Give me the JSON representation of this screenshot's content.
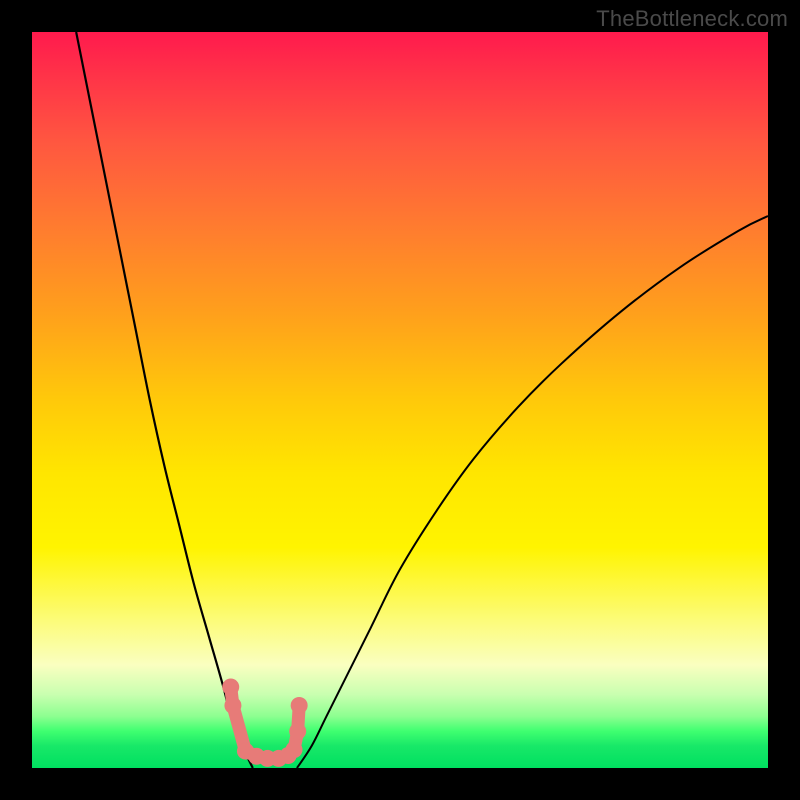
{
  "watermark": "TheBottleneck.com",
  "chart_data": {
    "type": "line",
    "title": "",
    "xlabel": "",
    "ylabel": "",
    "xlim": [
      0,
      100
    ],
    "ylim": [
      0,
      100
    ],
    "grid": false,
    "legend": false,
    "series": [
      {
        "name": "left-curve",
        "x": [
          6,
          8,
          10,
          12,
          14,
          16,
          18,
          20,
          22,
          24,
          26,
          27,
          28,
          29,
          30
        ],
        "y": [
          100,
          90,
          80,
          70,
          60,
          50,
          41,
          33,
          25,
          18,
          11,
          7,
          4,
          2,
          0
        ]
      },
      {
        "name": "right-curve",
        "x": [
          36,
          38,
          40,
          43,
          46,
          50,
          55,
          60,
          66,
          72,
          80,
          88,
          96,
          100
        ],
        "y": [
          0,
          3,
          7,
          13,
          19,
          27,
          35,
          42,
          49,
          55,
          62,
          68,
          73,
          75
        ]
      },
      {
        "name": "bottom-markers",
        "x": [
          27.0,
          27.3,
          29.0,
          30.5,
          32.0,
          33.5,
          34.8,
          35.6,
          36.1,
          36.3
        ],
        "y": [
          11.0,
          8.5,
          2.3,
          1.6,
          1.3,
          1.3,
          1.7,
          2.5,
          5.0,
          8.5
        ]
      }
    ],
    "marker_color": "#e77b78",
    "curve_color": "#000000"
  }
}
